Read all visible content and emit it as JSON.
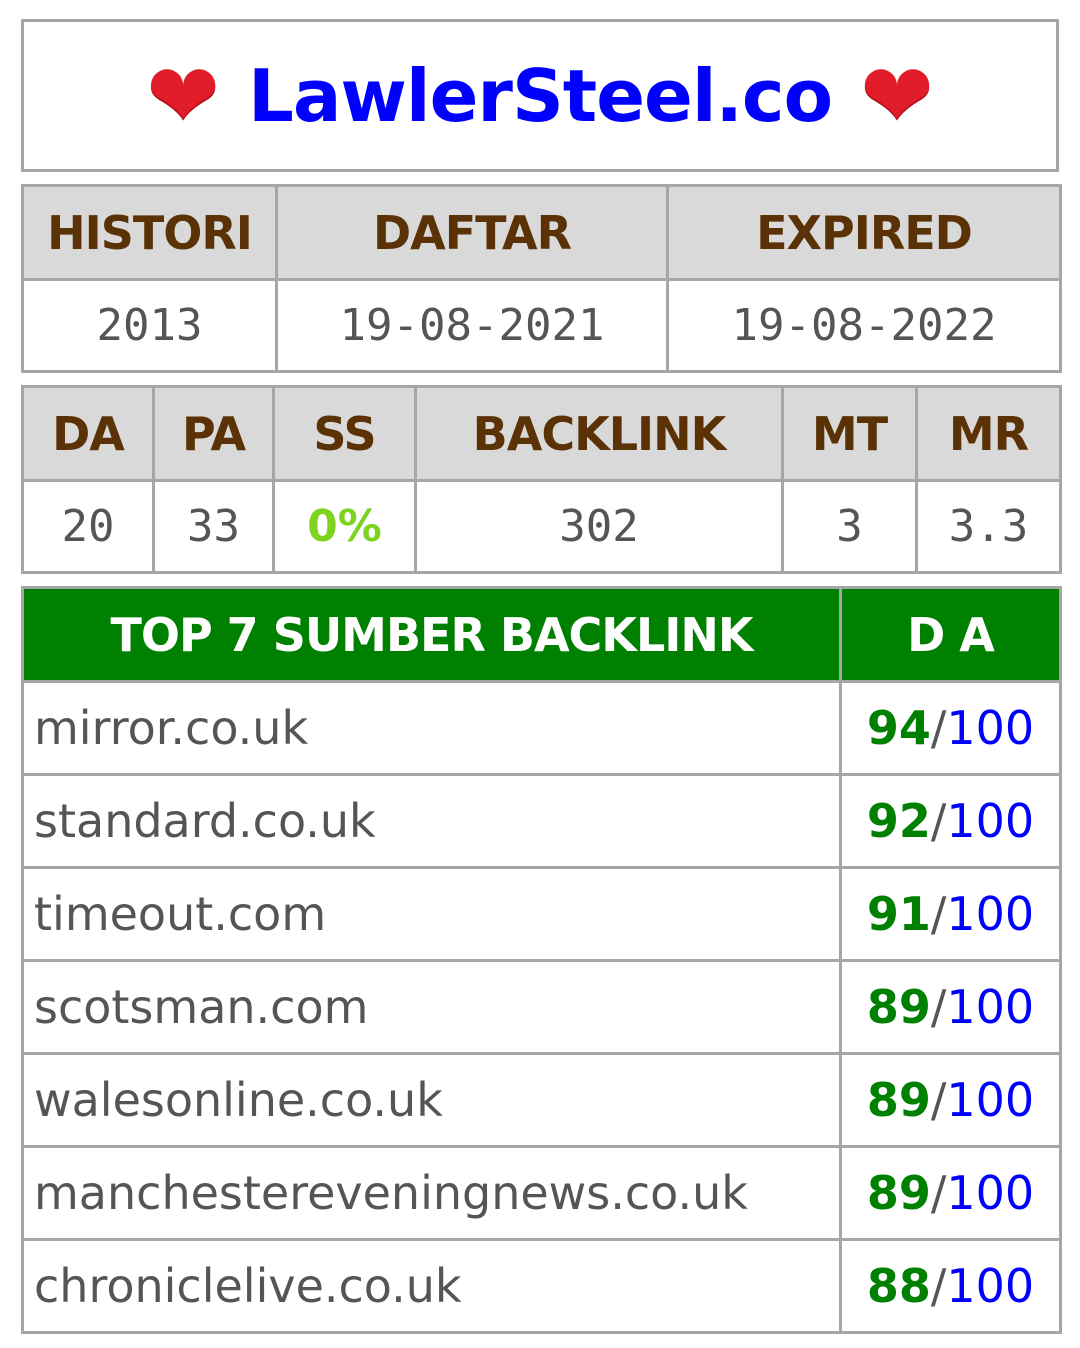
{
  "header": {
    "site": "LawlerSteel.co",
    "heart_icon": "❤"
  },
  "info1": {
    "headers": [
      "HISTORI",
      "DAFTAR",
      "EXPIRED"
    ],
    "values": [
      "2013",
      "19-08-2021",
      "19-08-2022"
    ]
  },
  "info2": {
    "headers": [
      "DA",
      "PA",
      "SS",
      "BACKLINK",
      "MT",
      "MR"
    ],
    "values": [
      "20",
      "33",
      "0%",
      "302",
      "3",
      "3.3"
    ]
  },
  "backlinks": {
    "title": "TOP 7 SUMBER BACKLINK",
    "da_header": "D A",
    "slash": "/",
    "max": "100",
    "rows": [
      {
        "domain": "mirror.co.uk",
        "da": "94"
      },
      {
        "domain": "standard.co.uk",
        "da": "92"
      },
      {
        "domain": "timeout.com",
        "da": "91"
      },
      {
        "domain": "scotsman.com",
        "da": "89"
      },
      {
        "domain": "walesonline.co.uk",
        "da": "89"
      },
      {
        "domain": "manchestereveningnews.co.uk",
        "da": "89"
      },
      {
        "domain": "chroniclelive.co.uk",
        "da": "88"
      }
    ]
  },
  "colors": {
    "title": "#0000ff",
    "header_text": "#5a3206",
    "header_bg": "#d9d9d9",
    "backlink_header_bg": "#008000",
    "ss_value": "#7ed321",
    "da_score": "#008000",
    "da_max": "#0000ff"
  }
}
